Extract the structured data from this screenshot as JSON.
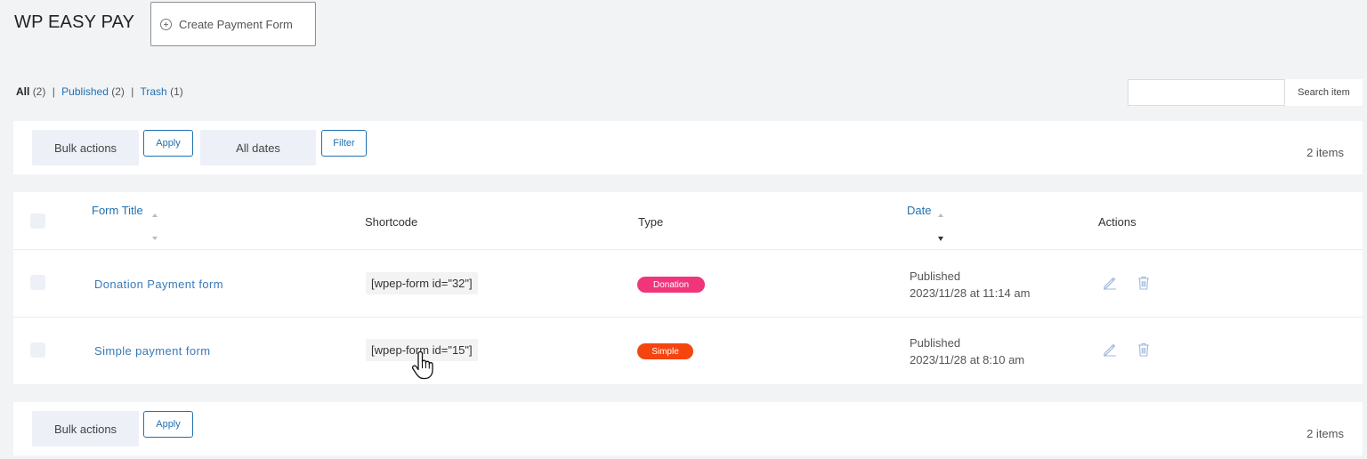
{
  "header": {
    "title": "WP EASY PAY",
    "create_label": "Create Payment Form"
  },
  "views": {
    "all_label": "All",
    "all_count": "(2)",
    "published_label": "Published",
    "published_count": "(2)",
    "trash_label": "Trash",
    "trash_count": "(1)",
    "separator": "|"
  },
  "search": {
    "value": "",
    "placeholder": "",
    "button_label": "Search item"
  },
  "toolbar_top": {
    "bulk_actions": "Bulk actions",
    "apply": "Apply",
    "dates": "All dates",
    "filter": "Filter",
    "items": "2 items"
  },
  "toolbar_bottom": {
    "bulk_actions": "Bulk actions",
    "apply": "Apply",
    "items": "2 items"
  },
  "table": {
    "columns": {
      "title": "Form Title",
      "shortcode": "Shortcode",
      "type": "Type",
      "date": "Date",
      "actions": "Actions"
    },
    "rows": [
      {
        "title": "Donation Payment form",
        "shortcode": "[wpep-form id=\"32\"]",
        "type": "Donation",
        "type_color": "#f0357a",
        "status": "Published",
        "date": "2023/11/28 at 11:14 am"
      },
      {
        "title": "Simple payment form",
        "shortcode": "[wpep-form id=\"15\"]",
        "type": "Simple",
        "type_color": "#f5450f",
        "status": "Published",
        "date": "2023/11/28 at 8:10 am"
      }
    ]
  },
  "colors": {
    "link": "#2271b1",
    "icon": "#9fb8dc"
  }
}
